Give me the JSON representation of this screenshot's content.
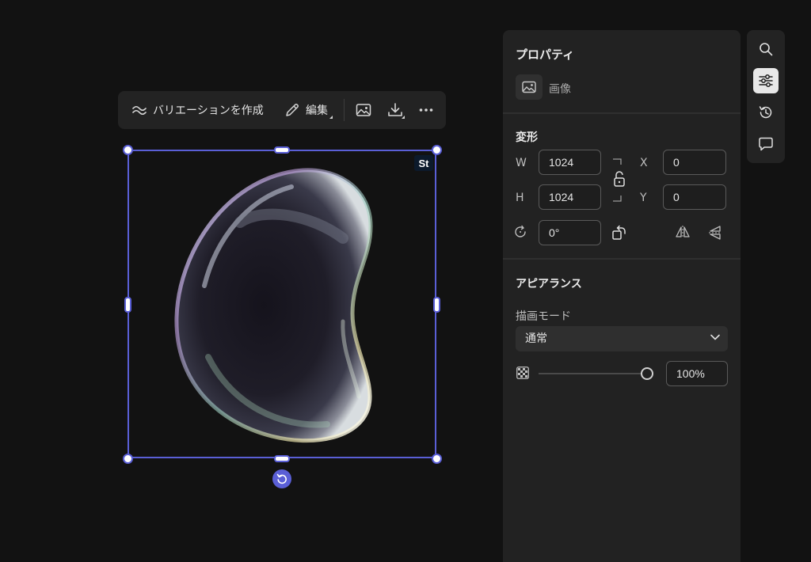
{
  "toolbar": {
    "variation_label": "バリエーションを作成",
    "edit_label": "編集",
    "icons": [
      "variation-icon",
      "pencil-icon",
      "image-icon",
      "download-icon",
      "more-icon"
    ]
  },
  "canvas": {
    "stock_badge": "St",
    "selection_color": "#5a5fd6"
  },
  "properties": {
    "title": "プロパティ",
    "type_label": "画像",
    "transform": {
      "title": "変形",
      "w_label": "W",
      "w_value": "1024",
      "h_label": "H",
      "h_value": "1024",
      "x_label": "X",
      "x_value": "0",
      "y_label": "Y",
      "y_value": "0",
      "rotation_value": "0°"
    },
    "appearance": {
      "title": "アピアランス",
      "blend_mode_label": "描画モード",
      "blend_mode_value": "通常",
      "opacity_value": "100%",
      "opacity_fraction": 1.0
    }
  },
  "rail": {
    "items": [
      "search-icon",
      "adjustments-icon",
      "history-icon",
      "comment-icon"
    ],
    "active": "adjustments-icon"
  },
  "colors": {
    "background": "#121212",
    "panel": "#222222",
    "accent": "#5a5fd6"
  }
}
